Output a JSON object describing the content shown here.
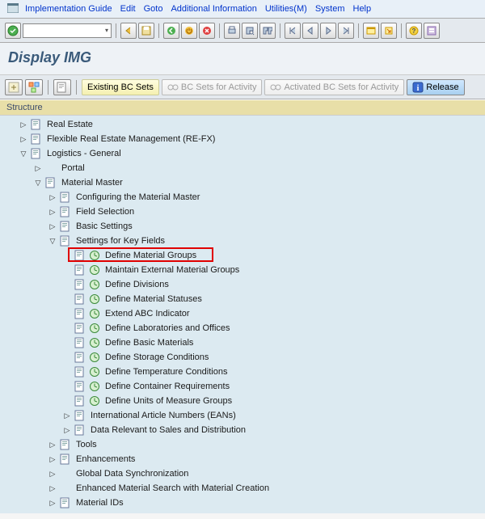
{
  "menu": {
    "items": [
      "Implementation Guide",
      "Edit",
      "Goto",
      "Additional Information",
      "Utilities(M)",
      "System",
      "Help"
    ]
  },
  "title": "Display IMG",
  "toolbar2": {
    "existing": "Existing BC Sets",
    "activity": "BC Sets for Activity",
    "activated": "Activated BC Sets for Activity",
    "release": "Release"
  },
  "structure_header": "Structure",
  "tree": [
    {
      "d": 1,
      "tog": "r",
      "ic": "doc",
      "t": "Real Estate"
    },
    {
      "d": 1,
      "tog": "r",
      "ic": "doc",
      "t": "Flexible Real Estate Management (RE-FX)"
    },
    {
      "d": 1,
      "tog": "d",
      "ic": "doc",
      "t": "Logistics - General"
    },
    {
      "d": 2,
      "tog": "r",
      "ic": "",
      "t": "Portal"
    },
    {
      "d": 2,
      "tog": "d",
      "ic": "doc",
      "t": "Material Master"
    },
    {
      "d": 3,
      "tog": "r",
      "ic": "doc",
      "t": "Configuring the Material Master"
    },
    {
      "d": 3,
      "tog": "r",
      "ic": "doc",
      "t": "Field Selection"
    },
    {
      "d": 3,
      "tog": "r",
      "ic": "doc",
      "t": "Basic Settings"
    },
    {
      "d": 3,
      "tog": "d",
      "ic": "doc",
      "t": "Settings for Key Fields"
    },
    {
      "d": 4,
      "tog": "",
      "ic": "act",
      "t": "Define Material Groups",
      "hl": true
    },
    {
      "d": 4,
      "tog": "",
      "ic": "act",
      "t": "Maintain External Material Groups"
    },
    {
      "d": 4,
      "tog": "",
      "ic": "act",
      "t": "Define Divisions"
    },
    {
      "d": 4,
      "tog": "",
      "ic": "act",
      "t": "Define Material Statuses"
    },
    {
      "d": 4,
      "tog": "",
      "ic": "act",
      "t": "Extend ABC Indicator"
    },
    {
      "d": 4,
      "tog": "",
      "ic": "act",
      "t": "Define Laboratories and Offices"
    },
    {
      "d": 4,
      "tog": "",
      "ic": "act",
      "t": "Define Basic Materials"
    },
    {
      "d": 4,
      "tog": "",
      "ic": "act",
      "t": "Define Storage Conditions"
    },
    {
      "d": 4,
      "tog": "",
      "ic": "act",
      "t": "Define Temperature Conditions"
    },
    {
      "d": 4,
      "tog": "",
      "ic": "act",
      "t": "Define Container Requirements"
    },
    {
      "d": 4,
      "tog": "",
      "ic": "act",
      "t": "Define Units of Measure Groups"
    },
    {
      "d": 4,
      "tog": "r",
      "ic": "doc",
      "t": "International Article Numbers (EANs)"
    },
    {
      "d": 4,
      "tog": "r",
      "ic": "doc",
      "t": "Data Relevant to Sales and Distribution"
    },
    {
      "d": 3,
      "tog": "r",
      "ic": "doc",
      "t": "Tools"
    },
    {
      "d": 3,
      "tog": "r",
      "ic": "doc",
      "t": "Enhancements"
    },
    {
      "d": 3,
      "tog": "r",
      "ic": "",
      "t": "Global Data Synchronization"
    },
    {
      "d": 3,
      "tog": "r",
      "ic": "",
      "t": "Enhanced Material Search with Material Creation"
    },
    {
      "d": 3,
      "tog": "r",
      "ic": "doc",
      "t": "Material IDs"
    }
  ]
}
